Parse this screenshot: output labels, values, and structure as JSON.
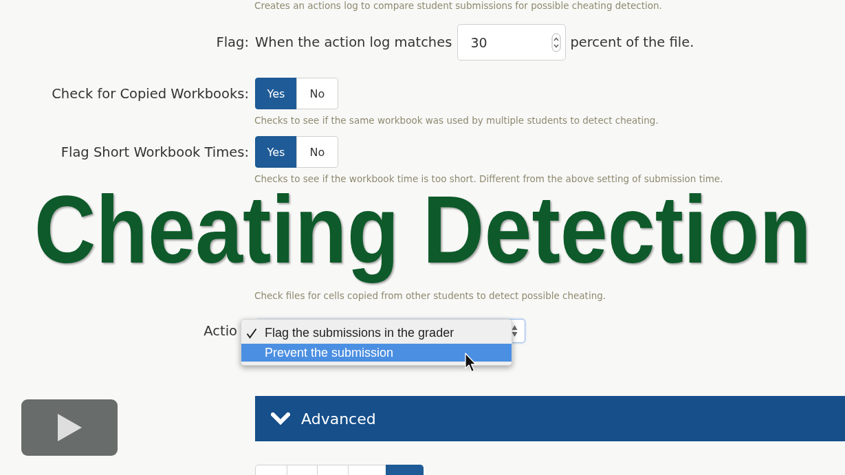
{
  "settings_top": [
    {
      "kind": "help",
      "text": "Creates an actions log to compare student submissions for possible cheating detection."
    },
    {
      "kind": "number",
      "label": "Flag:",
      "prefix": "When the action log matches",
      "value": "30",
      "suffix": "percent of the file."
    },
    {
      "kind": "toggle",
      "label": "Check for Copied Workbooks:",
      "options": [
        {
          "label": "Yes",
          "selected": true
        },
        {
          "label": "No",
          "selected": false
        }
      ],
      "help": "Checks to see if the same workbook was used by multiple students to detect cheating."
    },
    {
      "kind": "toggle",
      "label": "Flag Short Workbook Times:",
      "options": [
        {
          "label": "Yes",
          "selected": true
        },
        {
          "label": "No",
          "selected": false
        }
      ],
      "help": "Checks to see if the workbook time is too short. Different from the above setting of submission time."
    }
  ],
  "title_overlay": {
    "text": "Cheating Detection"
  },
  "settings_bottom": [
    {
      "kind": "help",
      "text": "Check files for cells copied from other students to detect possible cheating."
    },
    {
      "kind": "select",
      "label": "Actio",
      "options": [
        {
          "label": "Flag the submissions in the grader",
          "selected": true,
          "highlighted": false
        },
        {
          "label": "Prevent the submission",
          "selected": false,
          "highlighted": true
        }
      ]
    }
  ],
  "advanced_panel": {
    "title": "Advanced"
  },
  "pagination": [
    {
      "selected": false
    },
    {
      "selected": false
    },
    {
      "selected": false
    },
    {
      "selected": false
    },
    {
      "selected": true
    }
  ]
}
